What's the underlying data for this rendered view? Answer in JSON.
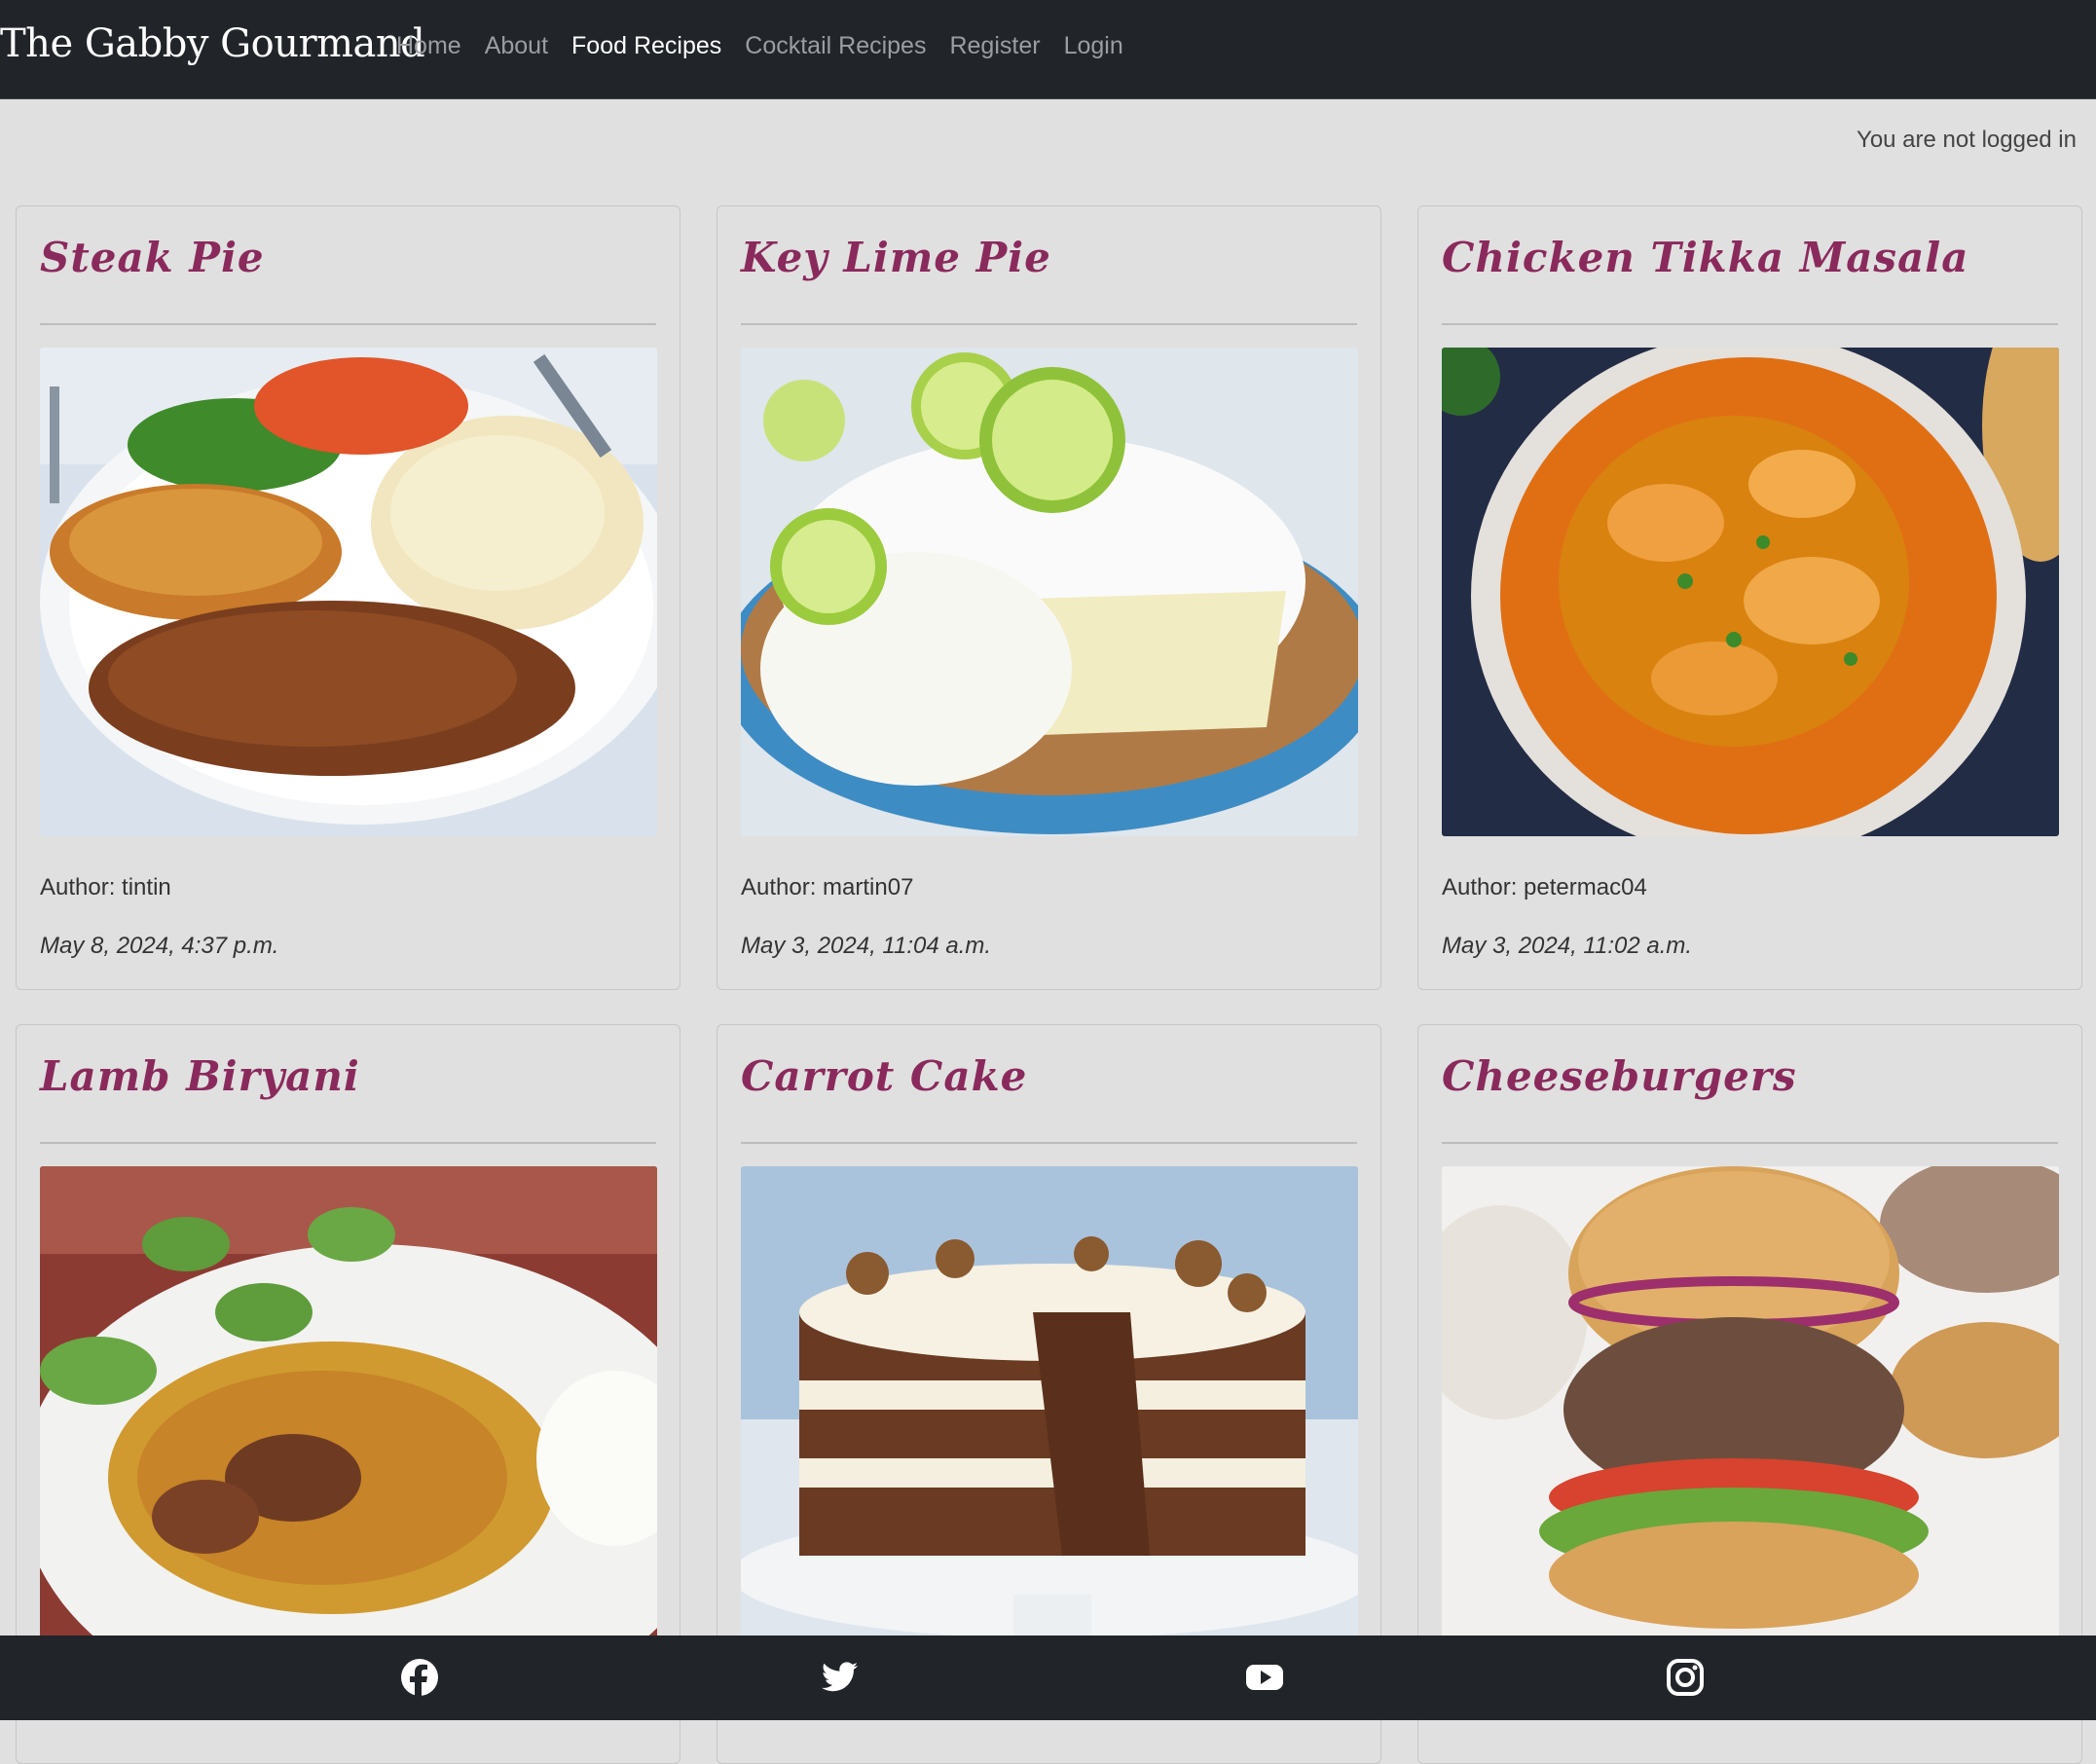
{
  "navbar": {
    "brand": "The Gabby Gourmand",
    "links": [
      {
        "label": "Home",
        "active": false
      },
      {
        "label": "About",
        "active": false
      },
      {
        "label": "Food Recipes",
        "active": true
      },
      {
        "label": "Cocktail Recipes",
        "active": false
      },
      {
        "label": "Register",
        "active": false
      },
      {
        "label": "Login",
        "active": false
      }
    ]
  },
  "status": {
    "login_text": "You are not logged in"
  },
  "recipes": [
    {
      "title": "Steak Pie",
      "author": "Author: tintin",
      "date": "May 8, 2024, 4:37 p.m."
    },
    {
      "title": "Key Lime Pie",
      "author": "Author: martin07",
      "date": "May 3, 2024, 11:04 a.m."
    },
    {
      "title": "Chicken Tikka Masala",
      "author": "Author: petermac04",
      "date": "May 3, 2024, 11:02 a.m."
    },
    {
      "title": "Lamb Biryani"
    },
    {
      "title": "Carrot Cake"
    },
    {
      "title": "Cheeseburgers"
    }
  ],
  "footer": {
    "social_icons": [
      "facebook-icon",
      "twitter-icon",
      "youtube-icon",
      "instagram-icon"
    ]
  },
  "colors": {
    "navbar_bg": "#212529",
    "page_bg": "#e0e0e0",
    "title_color": "#8a2a5c",
    "nav_active": "#ffffff",
    "nav_inactive": "#9a9da1"
  }
}
